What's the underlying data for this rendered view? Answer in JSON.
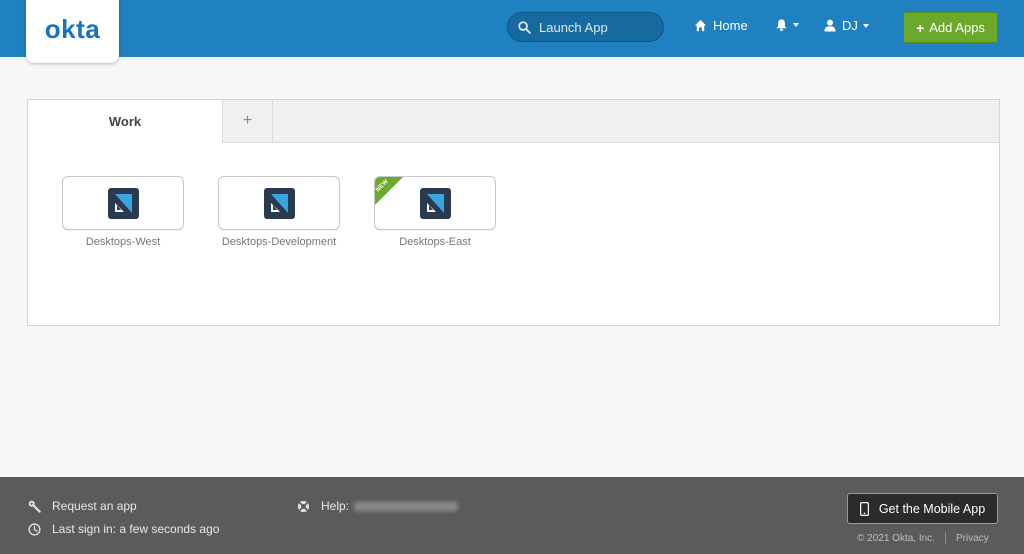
{
  "header": {
    "logo": "okta",
    "search_placeholder": "Launch App",
    "home_label": "Home",
    "user_label": "DJ",
    "add_apps_label": "Add Apps"
  },
  "tabs": [
    {
      "label": "Work",
      "active": true
    },
    {
      "label": "+",
      "active": false
    }
  ],
  "apps": [
    {
      "label": "Desktops-West",
      "badge": ""
    },
    {
      "label": "Desktops-Development",
      "badge": ""
    },
    {
      "label": "Desktops-East",
      "badge": "NEW"
    }
  ],
  "footer": {
    "request_app": "Request an app",
    "last_signin": "Last sign in: a few seconds ago",
    "help_label": "Help:",
    "mobile_app_button": "Get the Mobile App",
    "copyright": "© 2021 Okta, Inc.",
    "privacy": "Privacy"
  },
  "colors": {
    "header_bg": "#1f81c0",
    "add_apps_bg": "#6ca82a",
    "new_badge": "#6bac2f",
    "footer_bg": "#5c5b5b"
  },
  "icons": [
    "search-icon",
    "home-icon",
    "bell-icon",
    "user-icon",
    "plus-icon",
    "app-icon",
    "wrench-icon",
    "clock-icon",
    "lifebuoy-icon",
    "mobile-phone-icon"
  ]
}
